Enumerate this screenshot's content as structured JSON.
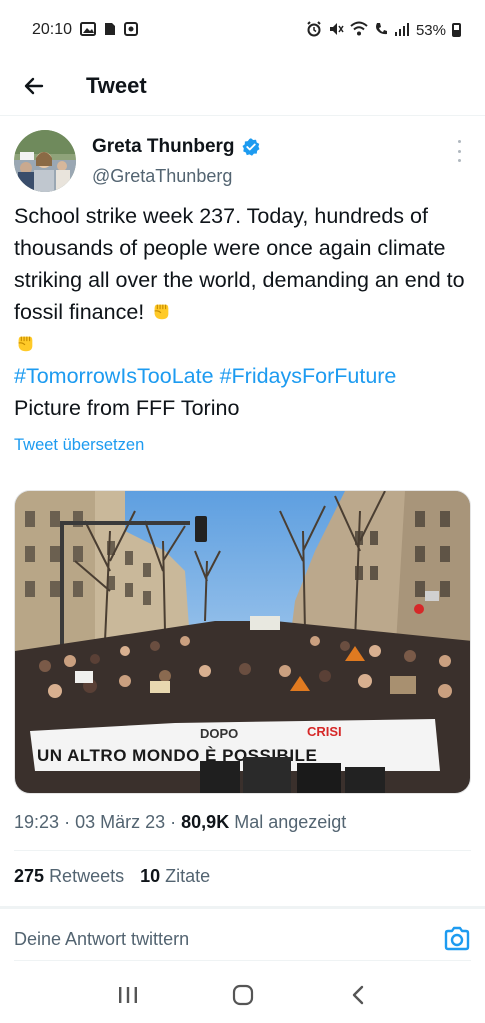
{
  "status_bar": {
    "time": "20:10",
    "battery": "53%"
  },
  "header": {
    "title": "Tweet",
    "back_icon": "arrow-left-icon"
  },
  "tweet": {
    "author_name": "Greta Thunberg",
    "author_handle": "@GretaThunberg",
    "text_main": "School strike week 237. Today, hundreds of thousands of people were once again climate striking all over the world, demanding an end to fossil finance!",
    "hashtag_1": "#TomorrowIsTooLate",
    "hashtag_2": "#FridaysForFuture",
    "text_picture": "Picture from FFF Torino",
    "translate_label": "Tweet übersetzen",
    "banner_text": {
      "line_1": "DOPO",
      "line_2": "CRISI",
      "line_3": "UN ALTRO MONDO È POSSIBILE"
    }
  },
  "meta": {
    "time": "19:23",
    "date": "03 März 23",
    "separator": "·",
    "views": "80,9K",
    "views_label": "Mal angezeigt"
  },
  "stats": {
    "retweets_count": "275",
    "retweets_label": "Retweets",
    "quotes_count": "10",
    "quotes_label": "Zitate"
  },
  "reply": {
    "placeholder": "Deine Antwort twittern"
  },
  "colors": {
    "accent": "#1d9bf0",
    "text": "#0f1419",
    "secondary": "#536471"
  }
}
